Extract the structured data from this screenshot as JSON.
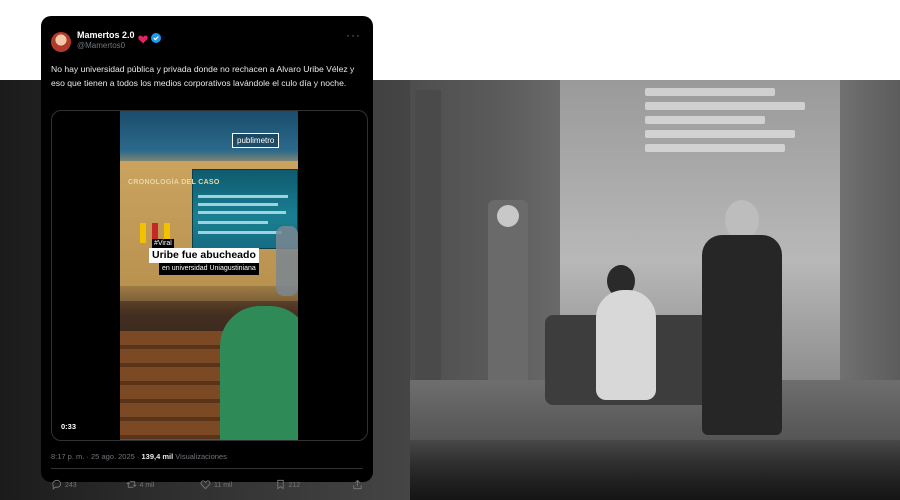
{
  "tweet": {
    "author": {
      "display_name": "Mamertos 2.0",
      "handle": "@Mamertos0",
      "verified": true,
      "emoji_icon": "red-heart-icon"
    },
    "text": "No hay universidad pública y privada donde no rechacen a Alvaro Uribe Vélez y eso que tienen a todos los medios corporativos lavándole el culo día y noche.",
    "video": {
      "brand": "publimetro",
      "screen_title": "CRONOLOGÍA DEL CASO",
      "tag_viral": "#Viral",
      "headline": "Uribe fue abucheado",
      "subheadline": "en universidad Uniagustiniana",
      "duration": "0:33"
    },
    "timestamp": "8:17 p. m. · 25 ago. 2025 ·",
    "views_count": "139,4 mil",
    "views_label": "Visualizaciones",
    "actions": {
      "replies": "243",
      "reposts": "4 mil",
      "likes": "11 mil",
      "bookmarks": "212"
    }
  },
  "colors": {
    "card_bg": "#000000",
    "text_primary": "#e7e9ea",
    "text_secondary": "#71767b",
    "verified_blue": "#1d9bf0"
  }
}
